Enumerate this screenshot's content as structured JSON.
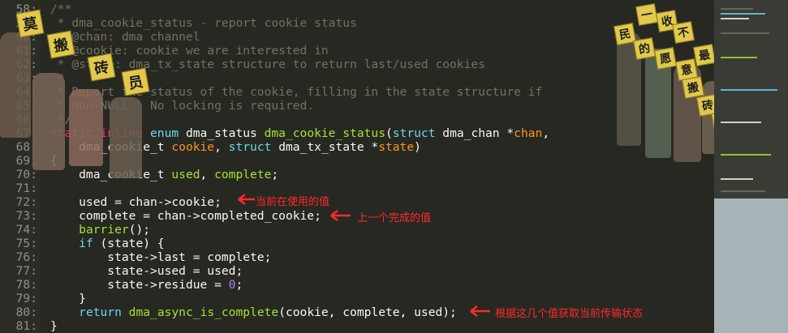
{
  "editor": {
    "lines": [
      {
        "n": "58:",
        "parts": [
          [
            "c",
            "/**"
          ]
        ]
      },
      {
        "n": "59:",
        "parts": [
          [
            "c",
            " * dma_cookie_status - report cookie status"
          ]
        ]
      },
      {
        "n": "60:",
        "parts": [
          [
            "c",
            " * @chan: dma channel"
          ]
        ]
      },
      {
        "n": "61:",
        "parts": [
          [
            "c",
            " * @cookie: cookie we are interested in"
          ]
        ]
      },
      {
        "n": "62:",
        "parts": [
          [
            "c",
            " * @state: dma_tx_state structure to return last/used cookies"
          ]
        ]
      },
      {
        "n": "63:",
        "parts": [
          [
            "c",
            " *"
          ]
        ]
      },
      {
        "n": "64:",
        "parts": [
          [
            "c",
            " * Report the status of the cookie, filling in the state structure if"
          ]
        ]
      },
      {
        "n": "65:",
        "parts": [
          [
            "c",
            " * non-NULL.  No locking is required."
          ]
        ]
      },
      {
        "n": "66:",
        "parts": [
          [
            "c",
            " */"
          ]
        ]
      },
      {
        "n": "67:",
        "parts": [
          [
            "kw",
            "static inline "
          ],
          [
            "k",
            "enum "
          ],
          [
            "t",
            "dma_status "
          ],
          [
            "f",
            "dma_cookie_status"
          ],
          [
            "t",
            "("
          ],
          [
            "k",
            "struct "
          ],
          [
            "t",
            "dma_chan *"
          ],
          [
            "p",
            "chan"
          ],
          [
            "t",
            ","
          ]
        ]
      },
      {
        "n": "68:",
        "parts": [
          [
            "t",
            "    dma_cookie_t "
          ],
          [
            "p",
            "cookie"
          ],
          [
            "t",
            ", "
          ],
          [
            "k",
            "struct "
          ],
          [
            "t",
            "dma_tx_state *"
          ],
          [
            "p",
            "state"
          ],
          [
            "t",
            ")"
          ]
        ]
      },
      {
        "n": "69:",
        "parts": [
          [
            "t",
            "{"
          ]
        ]
      },
      {
        "n": "70:",
        "parts": [
          [
            "t",
            "    dma_cookie_t "
          ],
          [
            "f",
            "used"
          ],
          [
            "t",
            ", "
          ],
          [
            "f",
            "complete"
          ],
          [
            "t",
            ";"
          ]
        ]
      },
      {
        "n": "71:",
        "parts": [
          [
            "t",
            ""
          ]
        ]
      },
      {
        "n": "72:",
        "parts": [
          [
            "t",
            "    used = chan->cookie;"
          ]
        ]
      },
      {
        "n": "73:",
        "parts": [
          [
            "t",
            "    complete = chan->completed_cookie;"
          ]
        ]
      },
      {
        "n": "74:",
        "parts": [
          [
            "t",
            "    "
          ],
          [
            "f",
            "barrier"
          ],
          [
            "t",
            "();"
          ]
        ]
      },
      {
        "n": "75:",
        "parts": [
          [
            "t",
            "    "
          ],
          [
            "k",
            "if"
          ],
          [
            "t",
            " (state) {"
          ]
        ]
      },
      {
        "n": "76:",
        "parts": [
          [
            "t",
            "        state->last = complete;"
          ]
        ]
      },
      {
        "n": "77:",
        "parts": [
          [
            "t",
            "        state->used = used;"
          ]
        ]
      },
      {
        "n": "78:",
        "parts": [
          [
            "t",
            "        state->residue = "
          ],
          [
            "num",
            "0"
          ],
          [
            "t",
            ";"
          ]
        ]
      },
      {
        "n": "79:",
        "parts": [
          [
            "t",
            "    }"
          ]
        ]
      },
      {
        "n": "80:",
        "parts": [
          [
            "t",
            "    "
          ],
          [
            "k",
            "return "
          ],
          [
            "f",
            "dma_async_is_complete"
          ],
          [
            "t",
            "(cookie, complete, used);"
          ]
        ]
      },
      {
        "n": "81:",
        "parts": [
          [
            "t",
            "}"
          ]
        ]
      }
    ]
  },
  "annotations": {
    "a1": "当前在使用的值",
    "a2": "上一个完成的值",
    "a3": "根据这几个值获取当前传输状态"
  },
  "decorations": {
    "left_signs": [
      "莫",
      "搬",
      "砖",
      "员"
    ],
    "right_signs": [
      "一",
      "收",
      "不",
      "民",
      "的",
      "愿",
      "意",
      "最",
      "搬",
      "砖",
      "员"
    ]
  },
  "colors": {
    "background": "#272822",
    "comment": "#75715e",
    "keyword": "#66d9ef",
    "storage": "#f92672",
    "function": "#a6e22e",
    "param": "#fd971f",
    "number": "#ae81ff",
    "annotation": "#ff2a2a"
  }
}
